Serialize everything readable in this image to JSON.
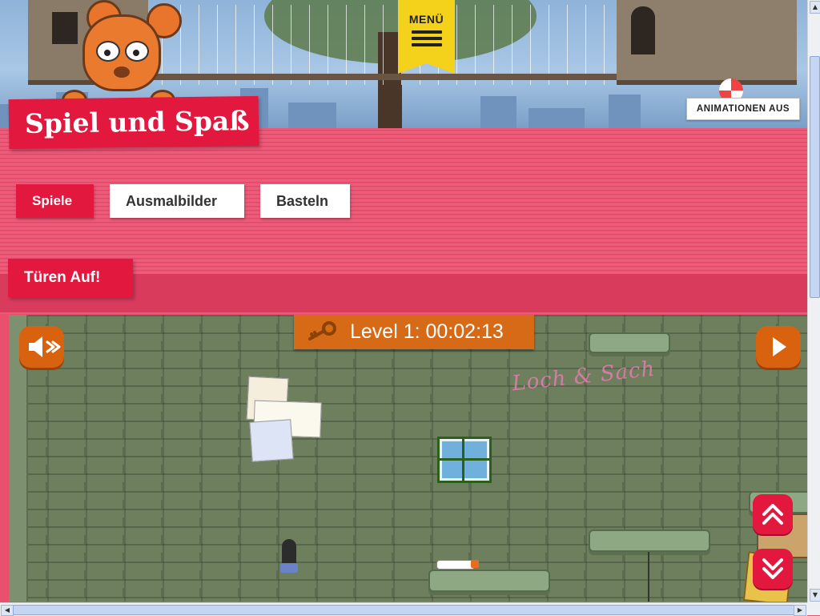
{
  "header": {
    "menu_label": "MENÜ",
    "animations_button": "ANIMATIONEN AUS",
    "page_title": "Spiel und Spaß"
  },
  "tabs": [
    {
      "label": "Spiele",
      "active": true
    },
    {
      "label": "Ausmalbilder",
      "active": false
    },
    {
      "label": "Basteln",
      "active": false
    }
  ],
  "game": {
    "heading": "Türen Auf!",
    "level_text": "Level 1: 00:02:13",
    "graffiti_text": "Loch & Sach",
    "icons": {
      "sound": "speaker-muted-icon",
      "play": "play-icon",
      "scroll_up": "double-chevron-up-icon",
      "scroll_down": "double-chevron-down-icon",
      "key": "key-icon"
    }
  },
  "colors": {
    "brand_red": "#e2183e",
    "pink_band": "#e9506d",
    "game_orange": "#d66a16",
    "menu_yellow": "#f4d21b",
    "brick_green": "#6e7f5e"
  }
}
